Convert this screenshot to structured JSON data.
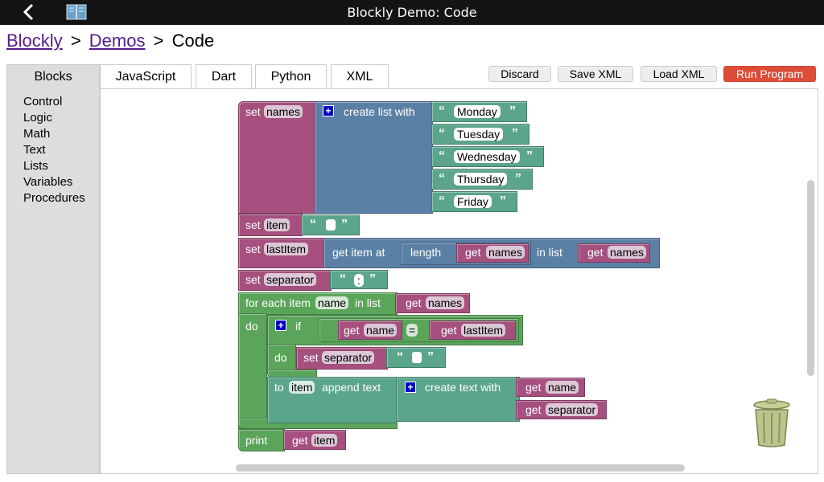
{
  "window": {
    "title": "Blockly Demo: Code"
  },
  "breadcrumb": {
    "blockly": "Blockly",
    "sep1": ">",
    "demos": "Demos",
    "sep2": ">",
    "current": "Code"
  },
  "tabs": [
    "Blocks",
    "JavaScript",
    "Dart",
    "Python",
    "XML"
  ],
  "toolbar": {
    "discard": "Discard",
    "save_xml": "Save XML",
    "load_xml": "Load XML",
    "run": "Run Program"
  },
  "categories": [
    "Control",
    "Logic",
    "Math",
    "Text",
    "Lists",
    "Variables",
    "Procedures"
  ],
  "program": {
    "set": "set",
    "names_var": "names",
    "create_list": "create list with",
    "days": [
      "Monday",
      "Tuesday",
      "Wednesday",
      "Thursday",
      "Friday"
    ],
    "item_var": "item",
    "lastitem_var": "lastItem",
    "get_item_at": "get item at",
    "length": "length",
    "get": "get",
    "in_list": "in list",
    "separator_var": "separator",
    "colon": ":",
    "for_each_item": "for each item",
    "in_list2": "in list",
    "name_var": "name",
    "do": "do",
    "if": "if",
    "equals": "=",
    "to": "to",
    "append_text": "append text",
    "create_text": "create text with",
    "print": "print",
    "open_quote": "“",
    "close_quote": "”"
  },
  "colors": {
    "variables": "#a5507f",
    "lists": "#5b80a5",
    "text": "#5ba58c",
    "control": "#5ba55b",
    "run_button": "#dd4b39"
  },
  "icons": {
    "back": "chevron-left-icon",
    "book": "book-icon",
    "trash": "trash-can-icon",
    "mutator": "plus-icon"
  }
}
